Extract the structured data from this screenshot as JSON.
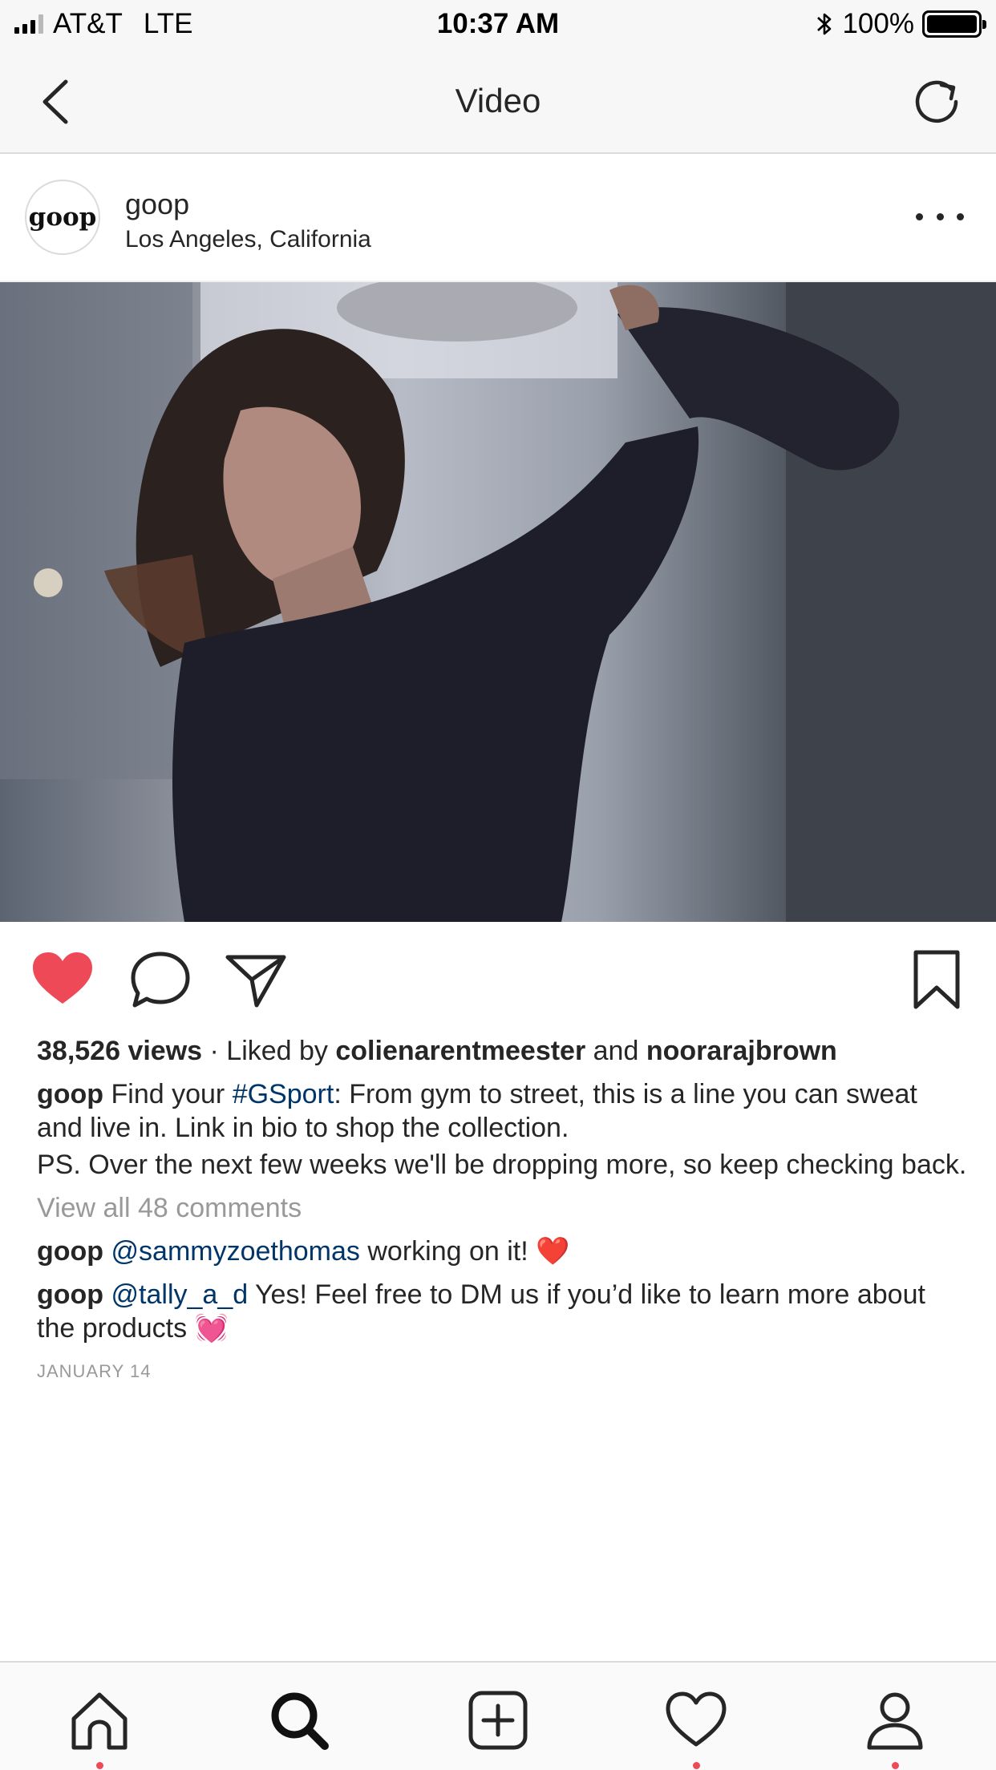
{
  "status_bar": {
    "carrier": "AT&T",
    "network": "LTE",
    "time": "10:37 AM",
    "battery": "100%",
    "battery_level": 1.0
  },
  "nav": {
    "title": "Video",
    "back_icon": "chevron-left-icon",
    "refresh_icon": "refresh-icon"
  },
  "post": {
    "username": "goop",
    "avatar_text": "goop",
    "location": "Los Angeles, California"
  },
  "engagement": {
    "views": "38,526 views",
    "separator": " · ",
    "liked_by_prefix": "Liked by ",
    "liker_1": "colienarentmeester",
    "and": " and ",
    "liker_2": "noorarajbrown",
    "liked": true
  },
  "caption": {
    "username": "goop",
    "text_1": " Find your ",
    "hashtag": "#GSport",
    "text_2": ": From gym to street, this is a line you can sweat and live in. Link in bio to shop the collection.",
    "ps": "PS. Over the next few weeks we'll be dropping more, so keep checking back."
  },
  "view_all_comments": "View all 48 comments",
  "comments": [
    {
      "username": "goop",
      "mention": "@sammyzoethomas",
      "text": " working on it! ❤️"
    },
    {
      "username": "goop",
      "mention": "@tally_a_d",
      "text": " Yes! Feel free to DM us if you’d like to learn more about the products 💓"
    }
  ],
  "date": "JANUARY 14",
  "colors": {
    "like_red": "#ed4956",
    "link_blue": "#003569",
    "muted_gray": "#999999"
  },
  "tab_bar": {
    "items": [
      "home-icon",
      "search-icon",
      "add-post-icon",
      "activity-heart-icon",
      "profile-icon"
    ]
  }
}
